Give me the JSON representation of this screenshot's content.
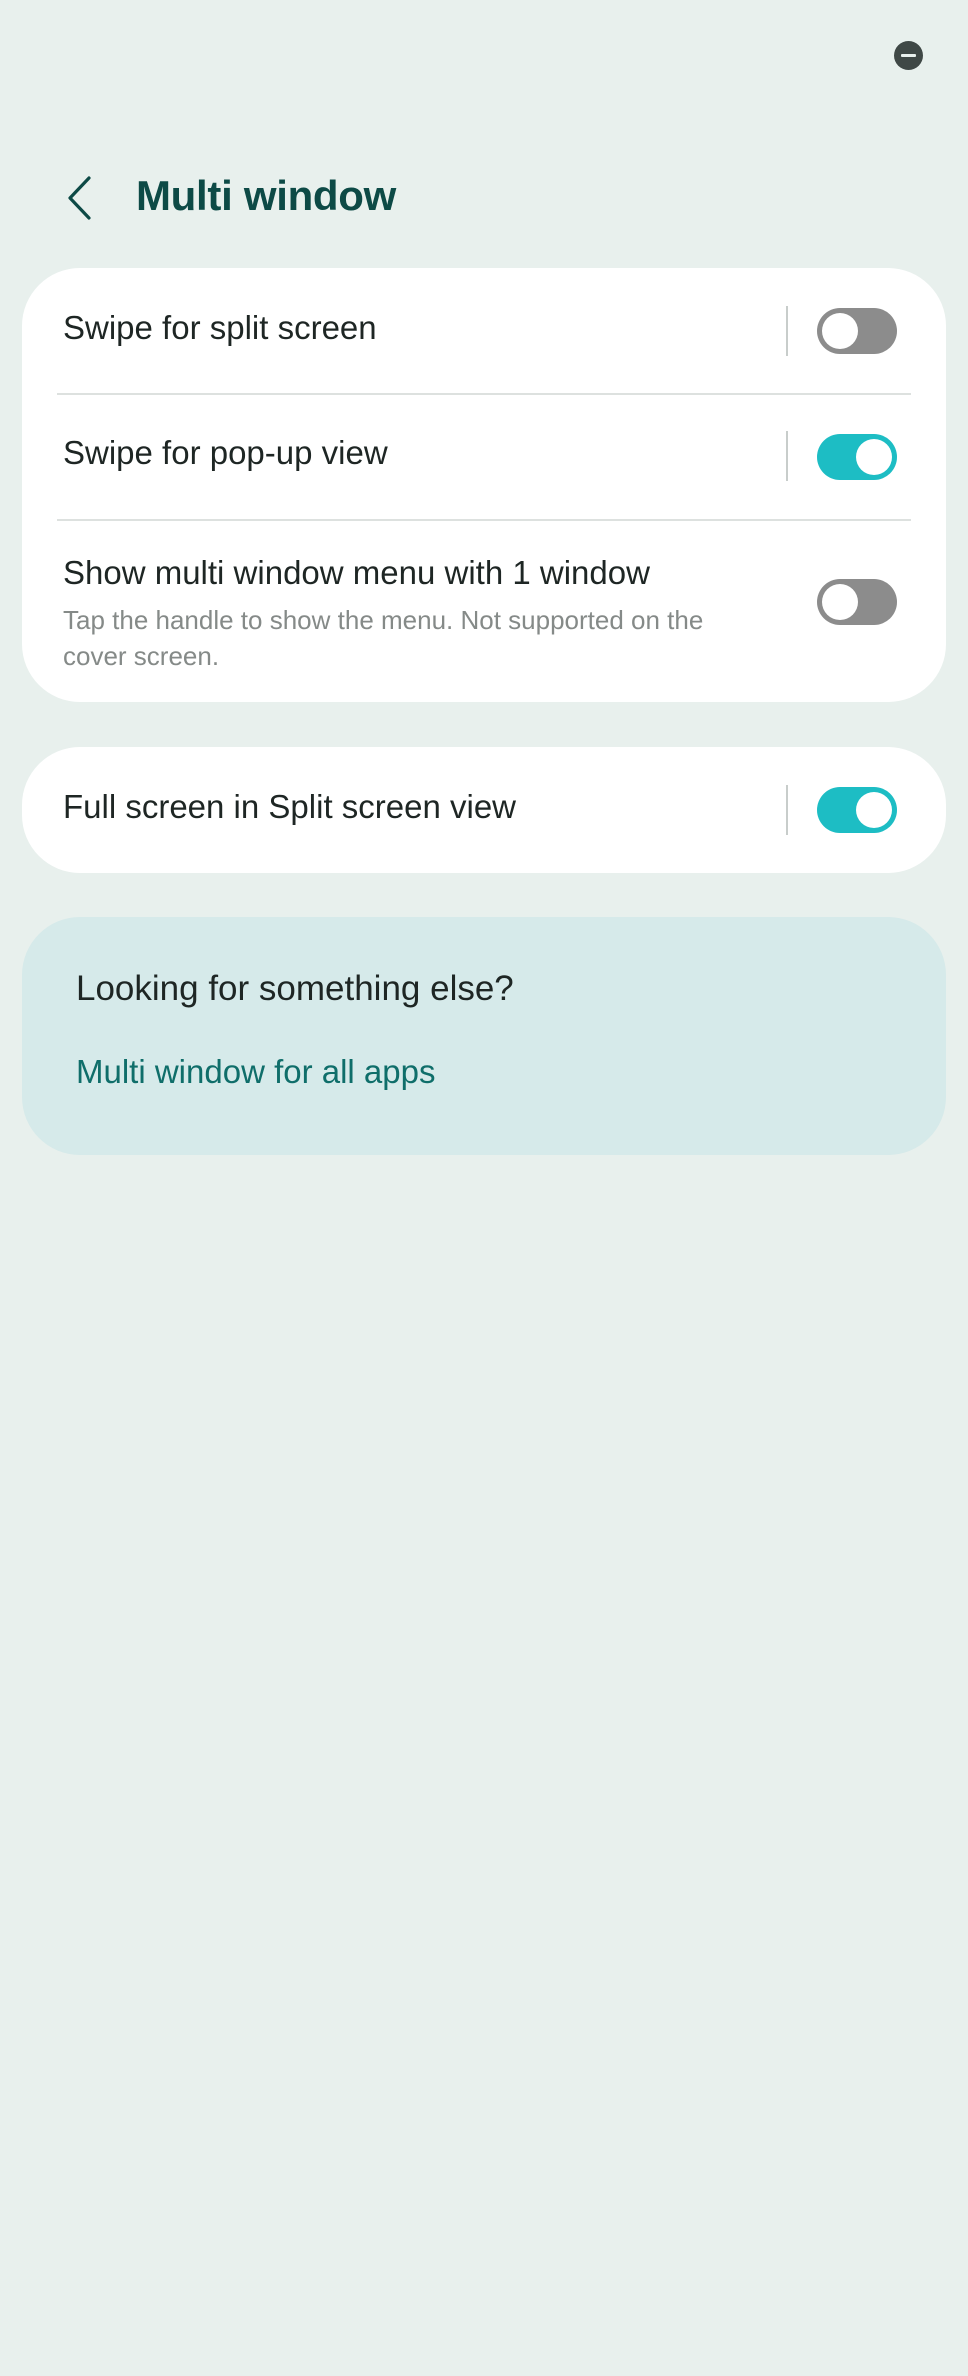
{
  "status_bar": {
    "icon": "do-not-disturb-icon"
  },
  "header": {
    "title": "Multi window",
    "back_icon": "back-chevron-icon"
  },
  "settings_group_1": [
    {
      "label": "Swipe for split screen",
      "enabled": false
    },
    {
      "label": "Swipe for pop-up view",
      "enabled": true
    },
    {
      "label": "Show multi window menu with 1 window",
      "sublabel": "Tap the handle to show the menu. Not supported on the cover screen.",
      "enabled": false
    }
  ],
  "settings_group_2": [
    {
      "label": "Full screen in Split screen view",
      "enabled": true
    }
  ],
  "suggestions": {
    "title": "Looking for something else?",
    "link": "Multi window for all apps"
  },
  "colors": {
    "background": "#e8f0ed",
    "title": "#0d4a46",
    "switch_on": "#1dbdc4",
    "switch_off": "#8c8c8c",
    "link": "#0f6e6a",
    "suggest_bg": "#d6eaea"
  }
}
